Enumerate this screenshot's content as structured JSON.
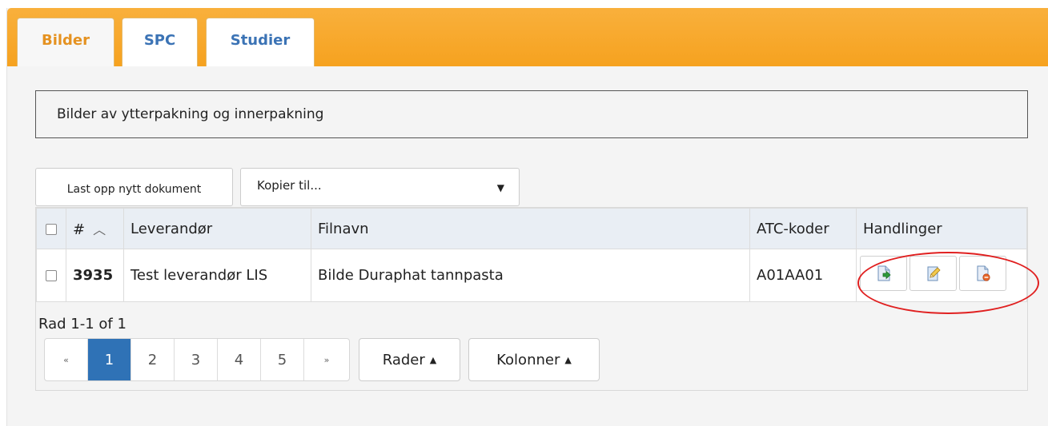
{
  "tabs": [
    {
      "label": "Bilder",
      "active": true
    },
    {
      "label": "SPC",
      "active": false
    },
    {
      "label": "Studier",
      "active": false
    }
  ],
  "description": "Bilder av ytterpakning og innerpakning",
  "toolbar": {
    "upload_label": "Last opp nytt dokument",
    "copy_select_value": "Kopier til..."
  },
  "table": {
    "headers": {
      "id": "#",
      "leverandor": "Leverandør",
      "filnavn": "Filnavn",
      "atc": "ATC-koder",
      "handlinger": "Handlinger"
    },
    "rows": [
      {
        "id": "3935",
        "leverandor": "Test leverandør LIS",
        "filnavn": "Bilde Duraphat tannpasta",
        "atc": "A01AA01"
      }
    ],
    "actions": [
      "download-icon",
      "edit-icon",
      "delete-icon"
    ]
  },
  "pagination": {
    "row_info": "Rad 1-1 of 1",
    "first": "«",
    "pages": [
      "1",
      "2",
      "3",
      "4",
      "5"
    ],
    "active_page": "1",
    "last": "»",
    "rows_button": "Rader",
    "columns_button": "Kolonner"
  },
  "colors": {
    "tabbar": "#f6a21f",
    "active_tab_text": "#e59221",
    "tab_text": "#3b73b5",
    "active_page": "#2f72b6",
    "annotation": "#e02020"
  }
}
